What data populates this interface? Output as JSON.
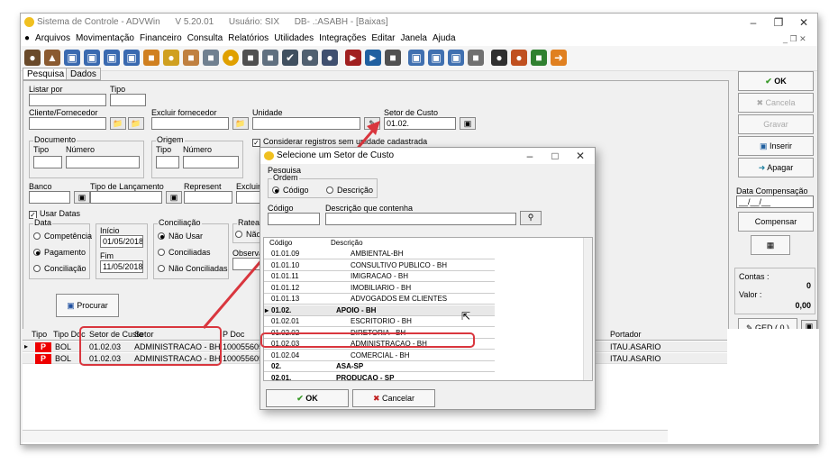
{
  "window": {
    "title": "Sistema de Controle - ADVWin",
    "version": "V 5.20.01",
    "user": "Usuário: SIX",
    "db": "DB- .:ASABH - [Baixas]"
  },
  "menu": [
    "Arquivos",
    "Movimentação",
    "Financeiro",
    "Consulta",
    "Relatórios",
    "Utilidades",
    "Integrações",
    "Editar",
    "Janela",
    "Ajuda"
  ],
  "tabs": [
    "Pesquisa",
    "Dados"
  ],
  "form": {
    "listar_por": "Listar por",
    "tipo": "Tipo",
    "cliente_fornecedor": "Cliente/Fornecedor",
    "excluir_fornecedor": "Excluir fornecedor",
    "unidade": "Unidade",
    "setor_de_custo": "Setor de Custo",
    "setor_de_custo_value": "01.02.",
    "considerar": "Considerar registros sem unidade cadastrada",
    "documento": "Documento",
    "doc_tipo": "Tipo",
    "doc_numero": "Número",
    "origem": "Origem",
    "orig_tipo": "Tipo",
    "orig_numero": "Número",
    "banco": "Banco",
    "tipo_lancamento": "Tipo de Lançamento",
    "represent": "Represent",
    "excluir_re": "Excluir Re",
    "usar_datas": "Usar Datas",
    "data": "Data",
    "competencia": "Competência",
    "pagamento": "Pagamento",
    "conciliacao": "Conciliação",
    "inicio": "Início",
    "inicio_value": "01/05/2018",
    "fim": "Fim",
    "fim_value": "11/05/2018",
    "conciliacao_group": "Conciliação",
    "nao_usar": "Não Usar",
    "conciliadas": "Conciliadas",
    "nao_conciliadas": "Não Conciliadas",
    "rateada": "Rateada",
    "rateada_nao": "Não",
    "observacao": "Observaç",
    "procurar": "Procurar"
  },
  "right": {
    "ok": "OK",
    "cancela": "Cancela",
    "gravar": "Gravar",
    "inserir": "Inserir",
    "apagar": "Apagar",
    "data_compensacao": "Data Compensação",
    "data_comp_value": "__/__/__",
    "compensar": "Compensar",
    "contas": "Contas :",
    "contas_value": "0",
    "valor": "Valor :",
    "valor_value": "0,00",
    "ged": "GED ( 0 )"
  },
  "grid": {
    "headers": [
      "Tipo",
      "Tipo Doc",
      "Setor de Custo",
      "Setor",
      "P Doc",
      "Portador"
    ],
    "rows": [
      {
        "tipo": "P",
        "tipo_doc": "BOL",
        "setor_custo": "01.02.03",
        "setor": "ADMINISTRACAO - BH",
        "doc": "100055605",
        "portador": "ITAU.ASARIO"
      },
      {
        "tipo": "P",
        "tipo_doc": "BOL",
        "setor_custo": "01.02.03",
        "setor": "ADMINISTRACAO - BH",
        "doc": "100055605",
        "portador": "ITAU.ASARIO"
      }
    ]
  },
  "dialog": {
    "title": "Selecione um Setor de Custo",
    "pesquisa": "Pesquisa",
    "ordem": "Ordem",
    "codigo_radio": "Código",
    "descricao_radio": "Descrição",
    "codigo": "Código",
    "descricao_que_contenha": "Descrição que contenha",
    "col_codigo": "Código",
    "col_descricao": "Descrição",
    "rows": [
      {
        "code": "01.01.09",
        "desc": "AMBIENTAL-BH",
        "bold": false
      },
      {
        "code": "01.01.10",
        "desc": "CONSULTIVO PUBLICO - BH",
        "bold": false
      },
      {
        "code": "01.01.11",
        "desc": "IMIGRACAO - BH",
        "bold": false
      },
      {
        "code": "01.01.12",
        "desc": "IMOBILIARIO - BH",
        "bold": false
      },
      {
        "code": "01.01.13",
        "desc": "ADVOGADOS EM CLIENTES",
        "bold": false
      },
      {
        "code": "01.02.",
        "desc": "APOIO - BH",
        "bold": true
      },
      {
        "code": "01.02.01",
        "desc": "ESCRITORIO - BH",
        "bold": false
      },
      {
        "code": "01.02.02",
        "desc": "DIRETORIA - BH",
        "bold": false
      },
      {
        "code": "01.02.03",
        "desc": "ADMINISTRACAO - BH",
        "bold": false
      },
      {
        "code": "01.02.04",
        "desc": "COMERCIAL - BH",
        "bold": false
      },
      {
        "code": "02.",
        "desc": "ASA-SP",
        "bold": true
      },
      {
        "code": "02.01.",
        "desc": "PRODUCAO - SP",
        "bold": true
      }
    ],
    "ok": "OK",
    "cancelar": "Cancelar"
  },
  "colors": {
    "highlight": "#d9363e",
    "badge": "#e00000"
  }
}
